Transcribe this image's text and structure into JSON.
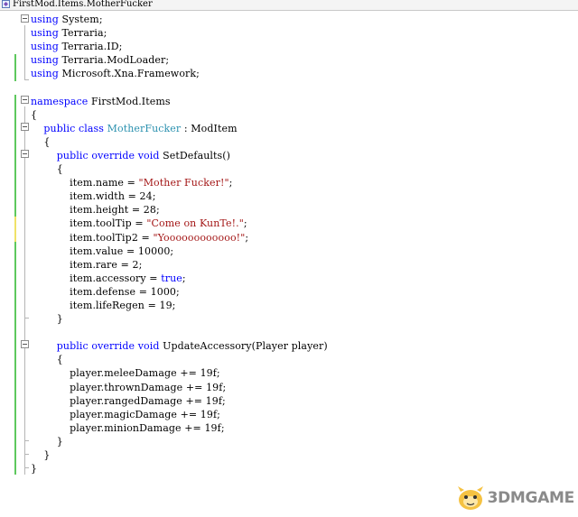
{
  "tab": {
    "title": "FirstMod.Items.MotherFucker",
    "icon": "csharp-file-icon"
  },
  "code_lines": [
    [
      {
        "t": "using",
        "c": "kw"
      },
      {
        "t": " System;",
        "c": ""
      }
    ],
    [
      {
        "t": "using",
        "c": "kw"
      },
      {
        "t": " Terraria;",
        "c": ""
      }
    ],
    [
      {
        "t": "using",
        "c": "kw"
      },
      {
        "t": " Terraria.ID;",
        "c": ""
      }
    ],
    [
      {
        "t": "using",
        "c": "kw"
      },
      {
        "t": " Terraria.ModLoader;",
        "c": ""
      }
    ],
    [
      {
        "t": "using",
        "c": "kw"
      },
      {
        "t": " Microsoft.Xna.Framework;",
        "c": ""
      }
    ],
    [],
    [
      {
        "t": "namespace",
        "c": "kw"
      },
      {
        "t": " FirstMod.Items",
        "c": ""
      }
    ],
    [
      {
        "t": "{",
        "c": ""
      }
    ],
    [
      {
        "t": "    public",
        "c": "kw"
      },
      {
        "t": " ",
        "c": ""
      },
      {
        "t": "class",
        "c": "kw"
      },
      {
        "t": " ",
        "c": ""
      },
      {
        "t": "MotherFucker",
        "c": "ty"
      },
      {
        "t": " : ModItem",
        "c": ""
      }
    ],
    [
      {
        "t": "    {",
        "c": ""
      }
    ],
    [
      {
        "t": "        public",
        "c": "kw"
      },
      {
        "t": " ",
        "c": ""
      },
      {
        "t": "override",
        "c": "kw"
      },
      {
        "t": " ",
        "c": ""
      },
      {
        "t": "void",
        "c": "kw"
      },
      {
        "t": " SetDefaults()",
        "c": ""
      }
    ],
    [
      {
        "t": "        {",
        "c": ""
      }
    ],
    [
      {
        "t": "            item.name = ",
        "c": ""
      },
      {
        "t": "\"Mother Fucker!\"",
        "c": "st"
      },
      {
        "t": ";",
        "c": ""
      }
    ],
    [
      {
        "t": "            item.width = 24;",
        "c": ""
      }
    ],
    [
      {
        "t": "            item.height = 28;",
        "c": ""
      }
    ],
    [
      {
        "t": "            item.toolTip = ",
        "c": ""
      },
      {
        "t": "\"Come on KunTe!.\"",
        "c": "st"
      },
      {
        "t": ";",
        "c": ""
      }
    ],
    [
      {
        "t": "            item.toolTip2 = ",
        "c": ""
      },
      {
        "t": "\"Yoooooooooooo!\"",
        "c": "st"
      },
      {
        "t": ";",
        "c": ""
      }
    ],
    [
      {
        "t": "            item.value = 10000;",
        "c": ""
      }
    ],
    [
      {
        "t": "            item.rare = 2;",
        "c": ""
      }
    ],
    [
      {
        "t": "            item.accessory = ",
        "c": ""
      },
      {
        "t": "true",
        "c": "kw"
      },
      {
        "t": ";",
        "c": ""
      }
    ],
    [
      {
        "t": "            item.defense = 1000;",
        "c": ""
      }
    ],
    [
      {
        "t": "            item.lifeRegen = 19;",
        "c": ""
      }
    ],
    [
      {
        "t": "        }",
        "c": ""
      }
    ],
    [],
    [
      {
        "t": "        public",
        "c": "kw"
      },
      {
        "t": " ",
        "c": ""
      },
      {
        "t": "override",
        "c": "kw"
      },
      {
        "t": " ",
        "c": ""
      },
      {
        "t": "void",
        "c": "kw"
      },
      {
        "t": " UpdateAccessory(Player player)",
        "c": ""
      }
    ],
    [
      {
        "t": "        {",
        "c": ""
      }
    ],
    [
      {
        "t": "            player.meleeDamage += 19f;",
        "c": ""
      }
    ],
    [
      {
        "t": "            player.thrownDamage += 19f;",
        "c": ""
      }
    ],
    [
      {
        "t": "            player.rangedDamage += 19f;",
        "c": ""
      }
    ],
    [
      {
        "t": "            player.magicDamage += 19f;",
        "c": ""
      }
    ],
    [
      {
        "t": "            player.minionDamage += 19f;",
        "c": ""
      }
    ],
    [
      {
        "t": "        }",
        "c": ""
      }
    ],
    [
      {
        "t": "    }",
        "c": ""
      }
    ],
    [
      {
        "t": "}",
        "c": ""
      }
    ]
  ],
  "watermark": {
    "text": "3DMGAME",
    "icon": "mascot-logo-icon"
  },
  "colors": {
    "keyword": "#0000ff",
    "type": "#2b91af",
    "string": "#a31515",
    "changed_saved": "#5ec85e",
    "changed_unsaved": "#f0e268"
  }
}
